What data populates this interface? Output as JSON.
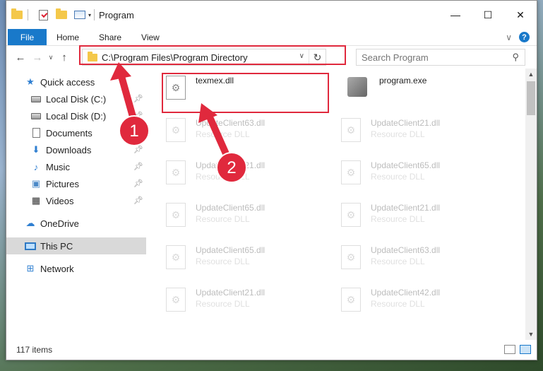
{
  "window": {
    "title": "Program",
    "controls": {
      "minimize": "—",
      "maximize": "☐",
      "close": "✕"
    }
  },
  "ribbon": {
    "tabs": [
      "File",
      "Home",
      "Share",
      "View"
    ],
    "help": "?",
    "expand": "∨"
  },
  "nav": {
    "back": "←",
    "forward": "→",
    "recent": "∨",
    "up": "↑",
    "address": "C:\\Program Files\\Program Directory",
    "refresh": "↻",
    "search_placeholder": "Search Program",
    "search_icon": "⚲"
  },
  "sidebar": {
    "items": [
      {
        "label": "Quick access",
        "icon": "star-icon",
        "glyph": "★",
        "pinned": false
      },
      {
        "label": "Local Disk (C:)",
        "icon": "disk-icon",
        "pinned": true
      },
      {
        "label": "Local Disk (D:)",
        "icon": "disk-icon",
        "pinned": true
      },
      {
        "label": "Documents",
        "icon": "documents-icon",
        "pinned": true
      },
      {
        "label": "Downloads",
        "icon": "downloads-icon",
        "glyph": "⬇",
        "pinned": true
      },
      {
        "label": "Music",
        "icon": "music-icon",
        "glyph": "♪",
        "pinned": true
      },
      {
        "label": "Pictures",
        "icon": "pictures-icon",
        "glyph": "▣",
        "pinned": true
      },
      {
        "label": "Videos",
        "icon": "videos-icon",
        "glyph": "▦",
        "pinned": true
      },
      {
        "label": "OneDrive",
        "icon": "cloud-icon",
        "glyph": "☁"
      },
      {
        "label": "This PC",
        "icon": "computer-icon"
      },
      {
        "label": "Network",
        "icon": "network-icon",
        "glyph": "⊞"
      }
    ]
  },
  "files": [
    {
      "name": "texmex.dll",
      "type": "",
      "kind": "dll"
    },
    {
      "name": "program.exe",
      "type": "",
      "kind": "exe"
    },
    {
      "name": "UpdateClient63.dll",
      "type": "Resource DLL",
      "kind": "dll"
    },
    {
      "name": "UpdateClient21.dll",
      "type": "Resource DLL",
      "kind": "dll"
    },
    {
      "name": "UpdateClient21.dll",
      "type": "Resource DLL",
      "kind": "dll"
    },
    {
      "name": "UpdateClient65.dll",
      "type": "Resource DLL",
      "kind": "dll"
    },
    {
      "name": "UpdateClient65.dll",
      "type": "Resource DLL",
      "kind": "dll"
    },
    {
      "name": "UpdateClient21.dll",
      "type": "Resource DLL",
      "kind": "dll"
    },
    {
      "name": "UpdateClient65.dll",
      "type": "Resource DLL",
      "kind": "dll"
    },
    {
      "name": "UpdateClient63.dll",
      "type": "Resource DLL",
      "kind": "dll"
    },
    {
      "name": "UpdateClient21.dll",
      "type": "Resource DLL",
      "kind": "dll"
    },
    {
      "name": "UpdateClient42.dll",
      "type": "Resource DLL",
      "kind": "dll"
    }
  ],
  "status": {
    "item_count": "117 items"
  },
  "annotations": {
    "color": "#e0293d",
    "steps": [
      "1",
      "2"
    ]
  }
}
